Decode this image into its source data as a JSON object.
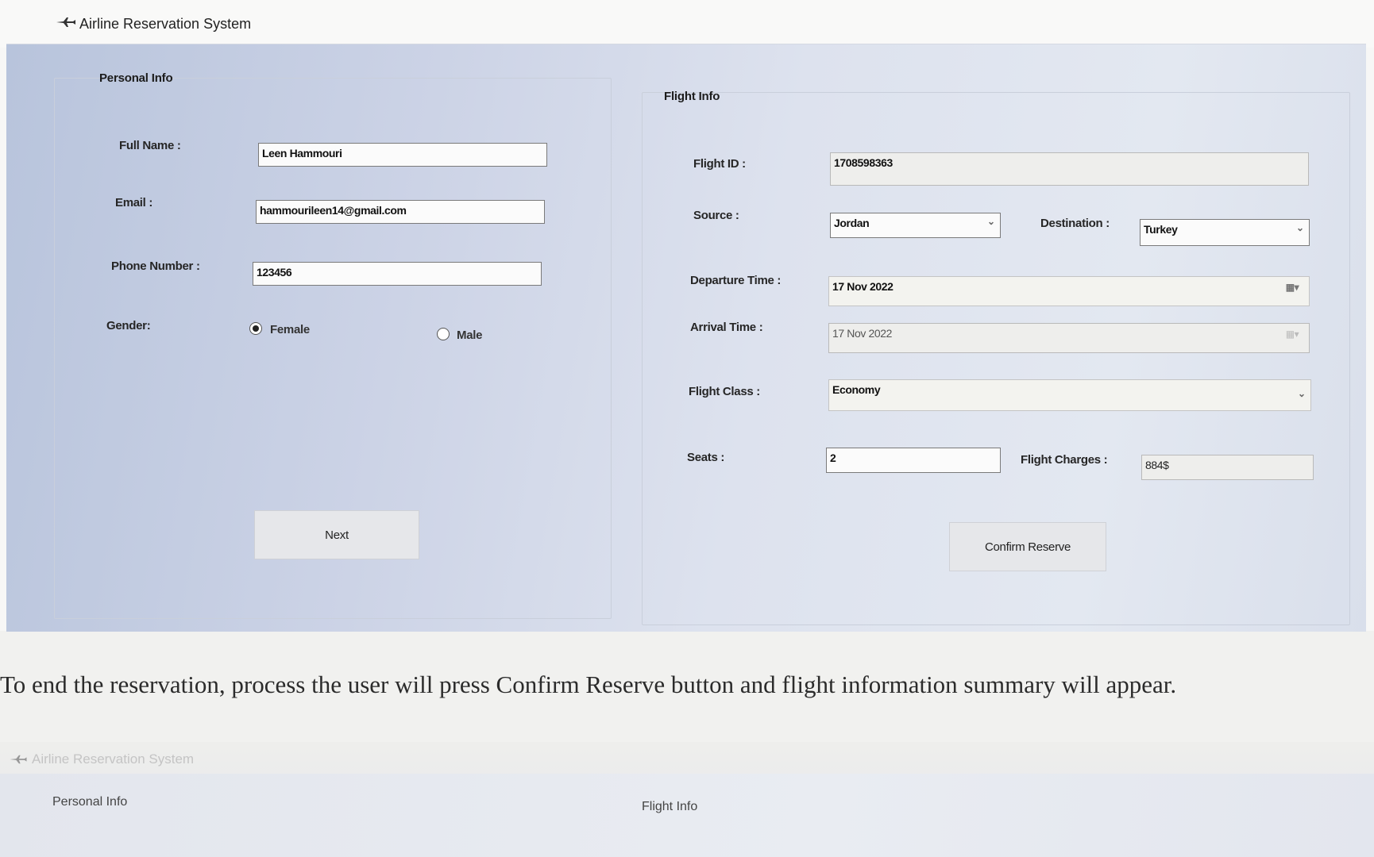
{
  "window": {
    "title": "Airline Reservation System",
    "controls": {
      "minimize": "—",
      "maximize": "☐",
      "close": "✕"
    }
  },
  "personal": {
    "group_title": "Personal Info",
    "full_name": {
      "label": "Full Name :",
      "value": "Leen Hammouri"
    },
    "email": {
      "label": "Email :",
      "value": "hammourileen14@gmail.com"
    },
    "phone": {
      "label": "Phone Number :",
      "value": "123456"
    },
    "gender": {
      "label": "Gender:",
      "options": [
        {
          "label": "Female",
          "checked": true
        },
        {
          "label": "Male",
          "checked": false
        }
      ]
    },
    "next_label": "Next"
  },
  "flight": {
    "group_title": "Flight Info",
    "flight_id": {
      "label": "Flight ID :",
      "value": "1708598363"
    },
    "source": {
      "label": "Source :",
      "value": "Jordan"
    },
    "destination": {
      "label": "Destination :",
      "value": "Turkey"
    },
    "departure": {
      "label": "Departure Time :",
      "value": "17 Nov 2022"
    },
    "arrival": {
      "label": "Arrival Time :",
      "value": "17 Nov 2022"
    },
    "flight_class": {
      "label": "Flight Class :",
      "value": "Economy"
    },
    "seats": {
      "label": "Seats :",
      "value": "2"
    },
    "charges": {
      "label": "Flight Charges :",
      "value": "884$"
    },
    "confirm_label": "Confirm Reserve"
  },
  "caption": "To end the reservation, process the user will press Confirm Reserve button and flight information summary will appear.",
  "window2": {
    "title": "Airline Reservation System",
    "personal_title": "Personal Info",
    "flight_title": "Flight Info"
  }
}
